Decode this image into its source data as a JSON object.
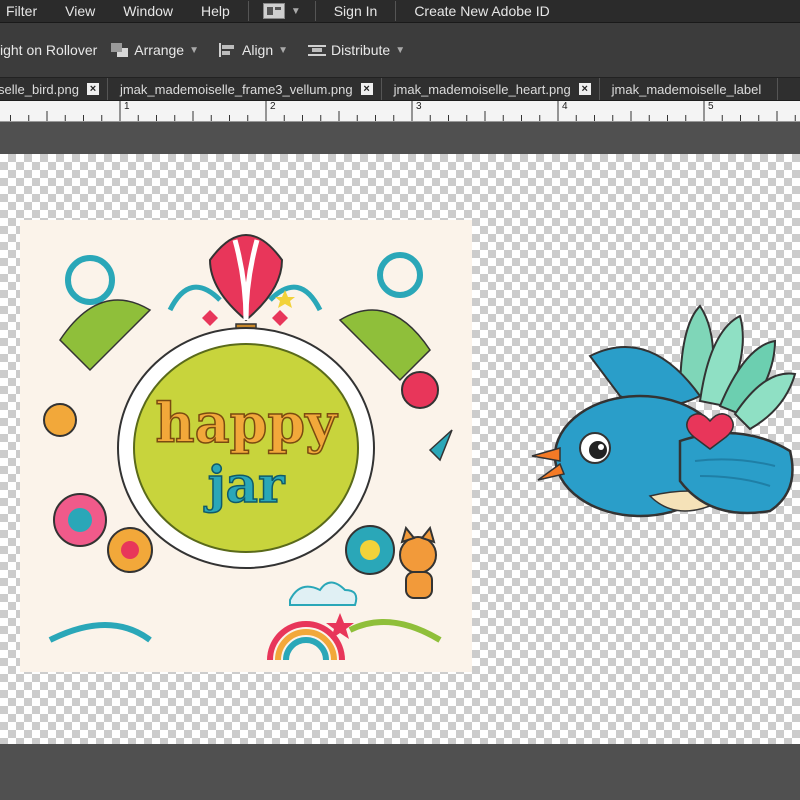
{
  "menubar": {
    "items": [
      "Filter",
      "View",
      "Window",
      "Help"
    ],
    "sign_in": "Sign In",
    "create_id": "Create New Adobe ID"
  },
  "options": {
    "rollover": "ight on Rollover",
    "arrange": "Arrange",
    "align": "Align",
    "distribute": "Distribute"
  },
  "tabs": [
    {
      "label": "selle_bird.png"
    },
    {
      "label": "jmak_mademoiselle_frame3_vellum.png"
    },
    {
      "label": "jmak_mademoiselle_heart.png"
    },
    {
      "label": "jmak_mademoiselle_label"
    }
  ],
  "ruler": {
    "numbers": [
      "1",
      "2",
      "3",
      "4",
      "5"
    ]
  },
  "artwork": {
    "jar_word1": "happy",
    "jar_word2": "jar",
    "colors": {
      "frame_bg": "#fbf3ea",
      "center": "#c8d43c",
      "bird": "#2a9ec9",
      "bird_dark": "#1f7fa6",
      "heart": "#e8365a",
      "beak": "#f47a26"
    }
  }
}
